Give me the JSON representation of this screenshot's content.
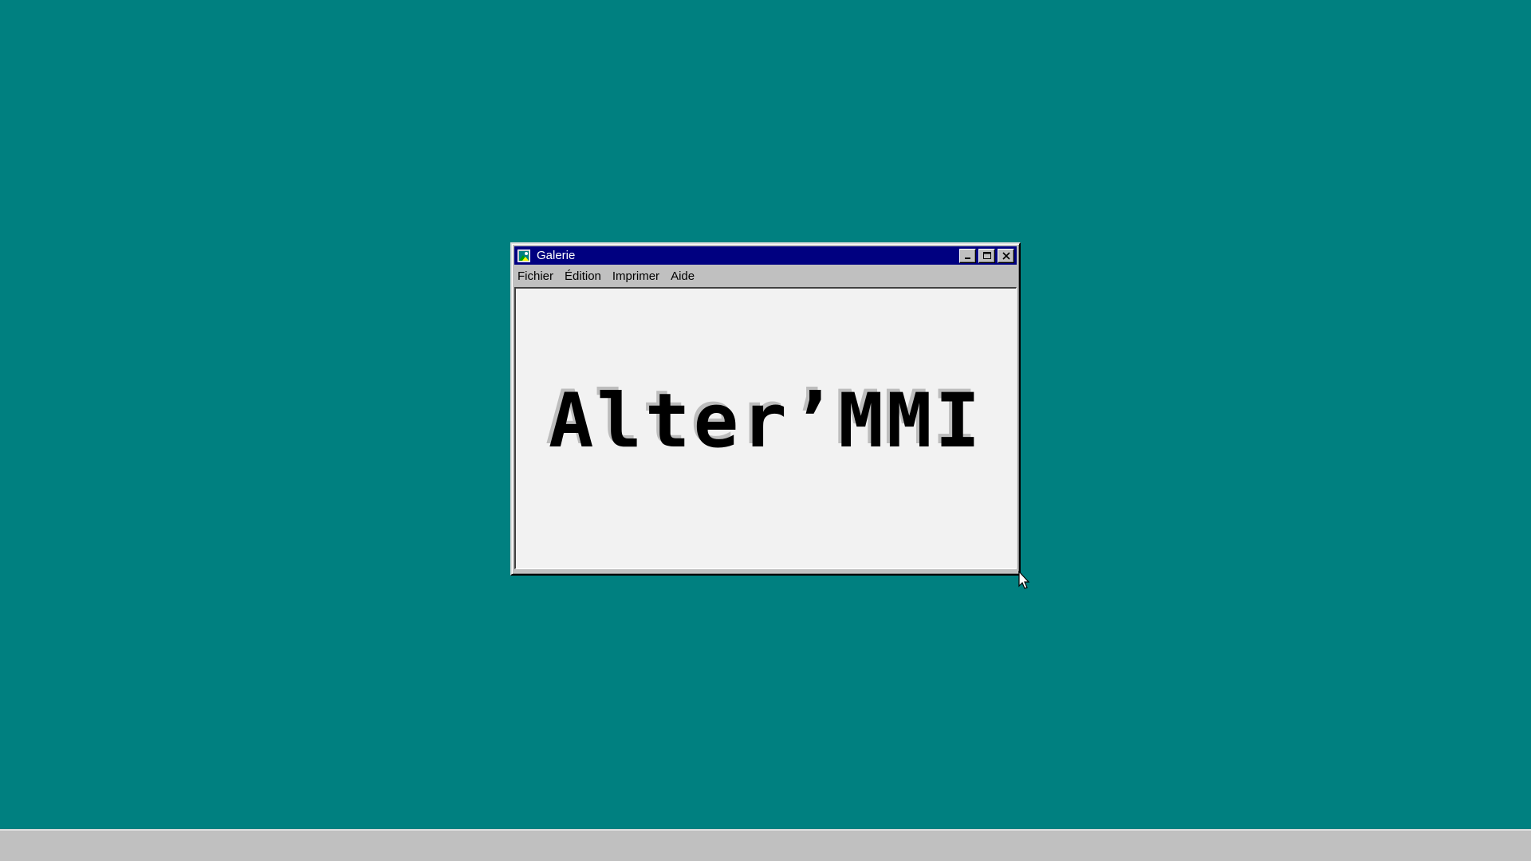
{
  "desktop": {
    "background_color": "#008080"
  },
  "window": {
    "title": "Galerie",
    "icon": "gallery-app-icon",
    "title_bar_color": "#000080",
    "controls": {
      "minimize_icon": "minimize-icon",
      "maximize_icon": "maximize-icon",
      "close_icon": "close-icon"
    },
    "menu": [
      {
        "label": "Fichier"
      },
      {
        "label": "Édition"
      },
      {
        "label": "Imprimer"
      },
      {
        "label": "Aide"
      }
    ],
    "canvas": {
      "text": "Alter’MMI",
      "background_color": "#f2f2f2"
    }
  },
  "taskbar": {
    "background_color": "#c0c0c0"
  },
  "cursor": {
    "icon": "arrow-cursor-icon"
  }
}
